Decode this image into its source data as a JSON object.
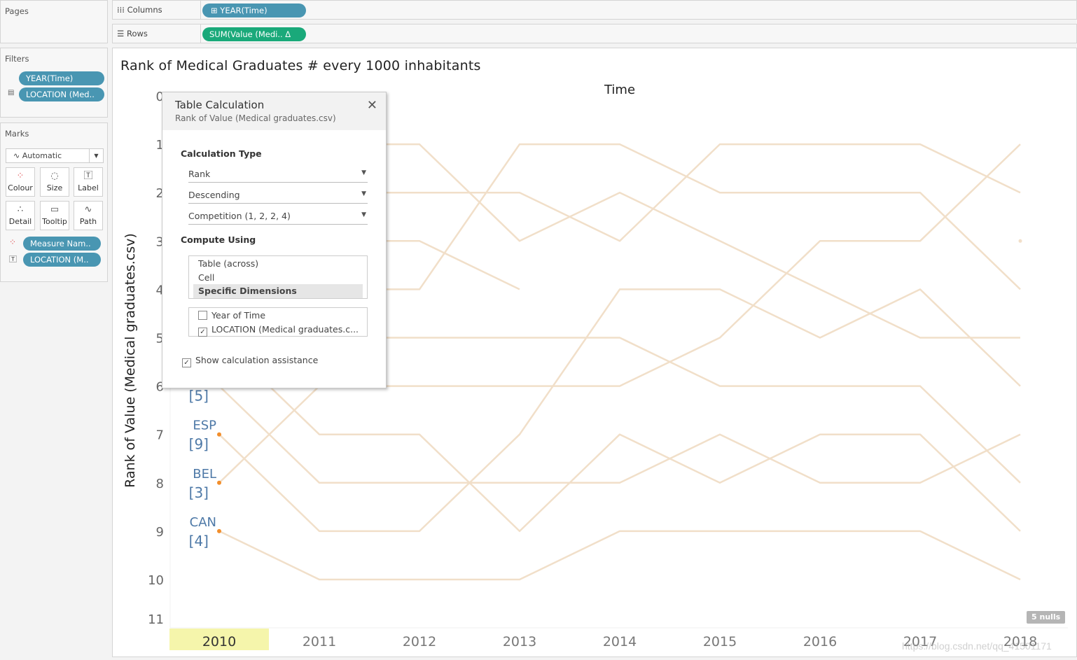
{
  "left_panel": {
    "pages_title": "Pages",
    "filters_title": "Filters",
    "filters": [
      "YEAR(Time)",
      "LOCATION (Med.."
    ],
    "marks_title": "Marks",
    "mark_type": "Automatic",
    "mark_buttons": [
      "Colour",
      "Size",
      "Label",
      "Detail",
      "Tooltip",
      "Path"
    ],
    "mark_fields": [
      "Measure Nam..",
      "LOCATION (M.."
    ]
  },
  "shelves": {
    "columns_label": "Columns",
    "columns_pill": "YEAR(Time)",
    "rows_label": "Rows",
    "rows_pill": "SUM(Value (Medi..  Δ"
  },
  "viz": {
    "title": "Rank of Medical Graduates # every 1000 inhabitants",
    "nulls_badge": "5 nulls",
    "watermark": "https://blog.csdn.net/qq_41501171"
  },
  "dialog": {
    "title": "Table Calculation",
    "subtitle": "Rank of Value (Medical graduates.csv)",
    "calc_type_label": "Calculation Type",
    "calc_type": "Rank",
    "order": "Descending",
    "rank_mode": "Competition (1, 2, 2, 4)",
    "compute_label": "Compute Using",
    "compute_options": [
      "Table (across)",
      "Cell",
      "Specific Dimensions"
    ],
    "compute_selected": "Specific Dimensions",
    "dimensions": [
      {
        "label": "Year of Time",
        "checked": false
      },
      {
        "label": "LOCATION (Medical graduates.c...",
        "checked": true
      }
    ],
    "assist_label": "Show calculation assistance",
    "assist_checked": true
  },
  "colors": {
    "line": "#f1dfc9",
    "dot": "#f28e2b",
    "label": "#4e79a7",
    "highlight": "#f5f5ab",
    "pill_blue": "#4996b2",
    "pill_green": "#1aa97a"
  },
  "chart_data": {
    "type": "line",
    "title": "Time",
    "ylabel": "Rank of Value (Medical graduates.csv)",
    "x": [
      "2010",
      "2011",
      "2012",
      "2013",
      "2014",
      "2015",
      "2016",
      "2017",
      "2018"
    ],
    "highlighted_x": "2010",
    "yticks": [
      "0",
      "1",
      "2",
      "3",
      "4",
      "5",
      "6",
      "7",
      "8",
      "9",
      "10",
      "11"
    ],
    "ylim": [
      0,
      11
    ],
    "y_reversed": true,
    "series": [
      {
        "values": [
          4,
          4,
          4,
          1,
          1,
          2,
          2,
          2,
          4
        ]
      },
      {
        "values": [
          1,
          1,
          1,
          3,
          2,
          3,
          4,
          5,
          5
        ]
      },
      {
        "values": [
          2,
          2,
          2,
          2,
          3,
          1,
          1,
          1,
          2
        ]
      },
      {
        "values": [
          8,
          6,
          6,
          6,
          6,
          5,
          3,
          3,
          1
        ],
        "label": "BEL",
        "label_value": "[3]"
      },
      {
        "values": [
          7,
          9,
          9,
          7,
          4,
          4,
          5,
          4,
          6
        ],
        "label": "ESP",
        "label_value": "[9]"
      },
      {
        "values": [
          null,
          5,
          5,
          5,
          5,
          6,
          6,
          6,
          8
        ]
      },
      {
        "values": [
          5,
          7,
          7,
          9,
          7,
          8,
          7,
          7,
          9
        ]
      },
      {
        "values": [
          6,
          8,
          8,
          8,
          8,
          7,
          8,
          8,
          7
        ],
        "label_value": "[5]"
      },
      {
        "values": [
          9,
          10,
          10,
          10,
          9,
          9,
          9,
          9,
          10
        ],
        "label": "CAN",
        "label_value": "[4]"
      },
      {
        "values": [
          3,
          3,
          3,
          4,
          null,
          null,
          null,
          null,
          null
        ]
      },
      {
        "values": [
          null,
          null,
          null,
          null,
          null,
          null,
          null,
          null,
          3
        ]
      }
    ]
  }
}
